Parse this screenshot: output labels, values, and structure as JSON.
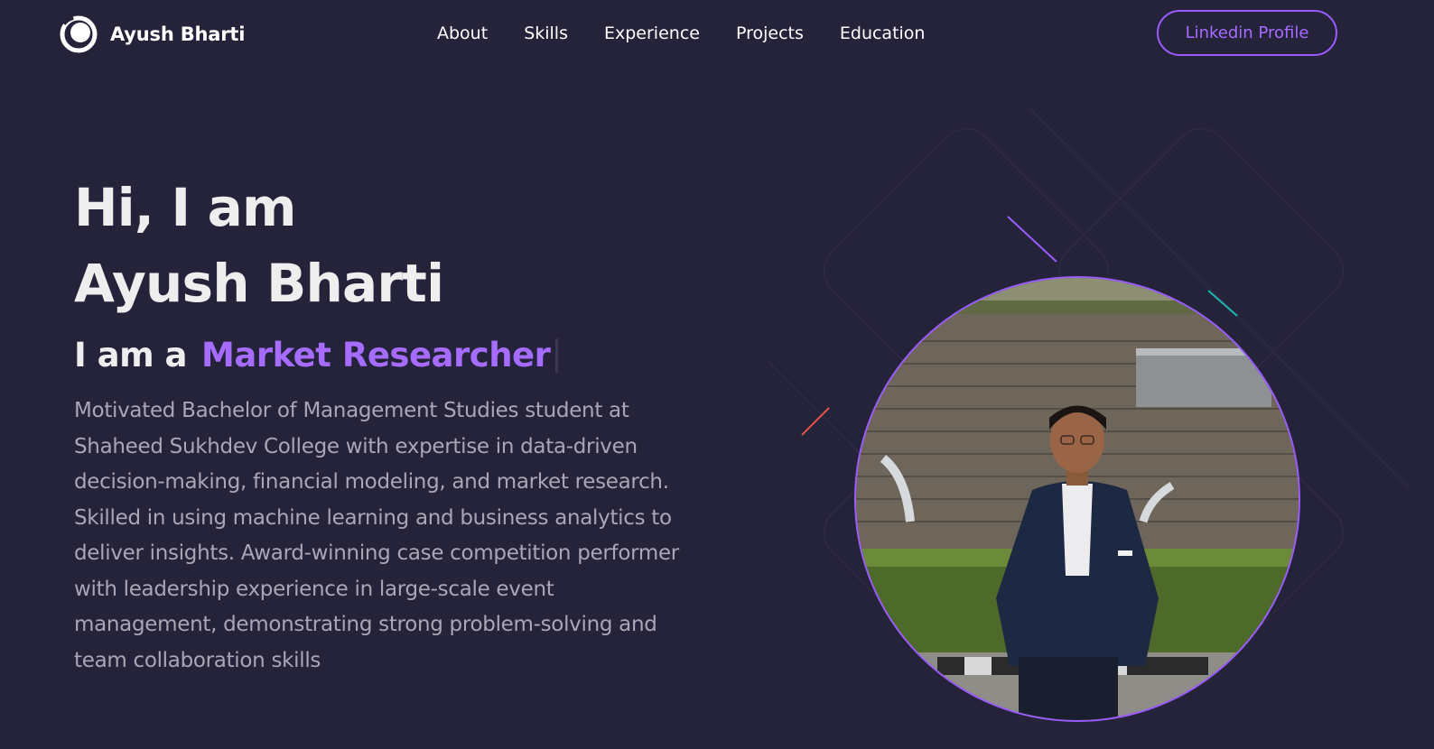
{
  "navbar": {
    "brand_name": "Ayush Bharti",
    "brand_icon": "circle-logo-icon",
    "links": [
      {
        "label": "About"
      },
      {
        "label": "Skills"
      },
      {
        "label": "Experience"
      },
      {
        "label": "Projects"
      },
      {
        "label": "Education"
      }
    ],
    "cta_label": "Linkedin Profile"
  },
  "hero": {
    "greeting": "Hi, I am",
    "name": "Ayush Bharti",
    "role_prefix": "I am a",
    "role_value": "Market Researcher",
    "description": "Motivated Bachelor of Management Studies student at Shaheed Sukhdev College with expertise in data-driven decision-making, financial modeling, and market research. Skilled in using machine learning and business analytics to deliver insights. Award-winning case competition performer with leadership experience in large-scale event management, demonstrating strong problem-solving and team collaboration skills"
  },
  "colors": {
    "background": "#25233a",
    "accent": "#9b5cff",
    "heading": "#eeeeee",
    "body_text": "#a9a6b5"
  }
}
